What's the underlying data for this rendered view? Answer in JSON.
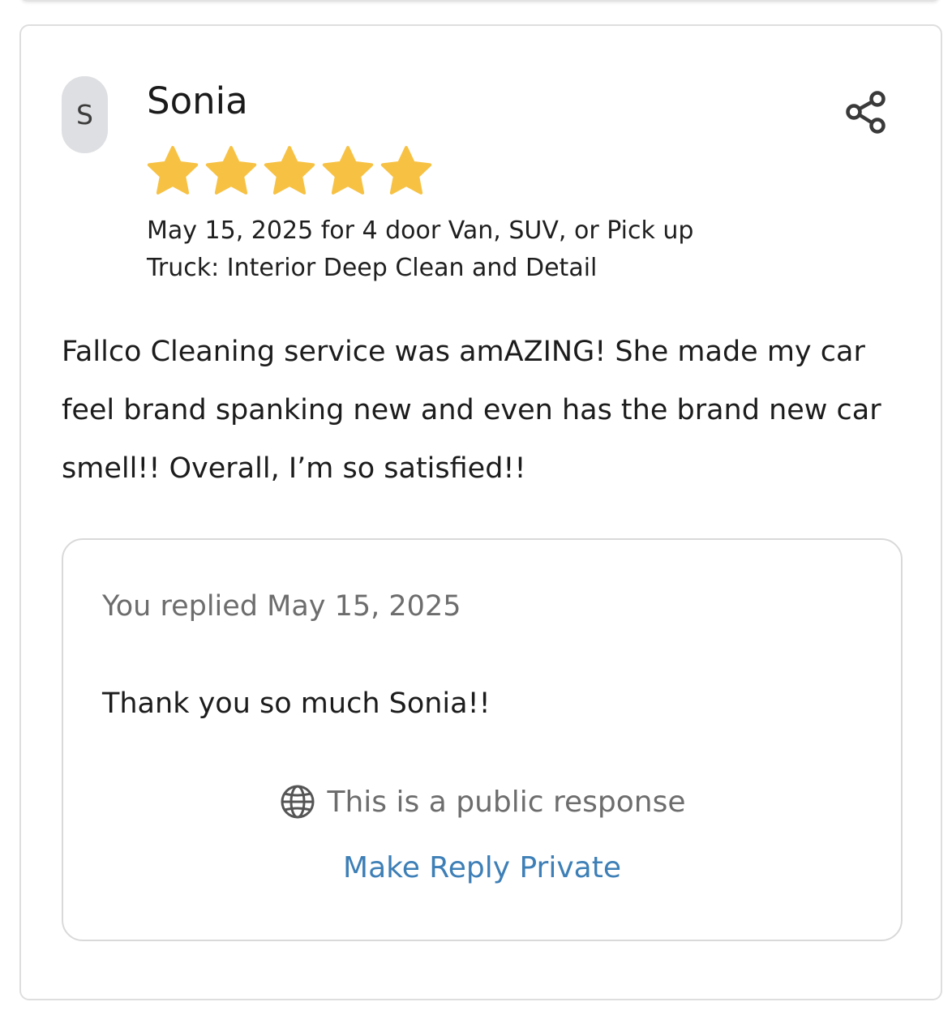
{
  "review": {
    "avatar_initial": "S",
    "reviewer_name": "Sonia",
    "rating": 5,
    "rating_max": 5,
    "star_color": "#f7c244",
    "meta": "May 15, 2025 for 4 door Van, SUV, or Pick up Truck: Interior Deep Clean and Detail",
    "body": "Fallco Cleaning service was amAZING! She made my car feel brand spanking new and even has the brand new car smell!! Overall, I’m so satisfied!!"
  },
  "icons": {
    "share": "share-icon",
    "globe": "globe-icon"
  },
  "reply": {
    "date_label": "You replied May 15, 2025",
    "text": "Thank you so much Sonia!!",
    "visibility_label": "This is a public response",
    "make_private_label": "Make Reply Private",
    "link_color": "#3d7fb6"
  }
}
